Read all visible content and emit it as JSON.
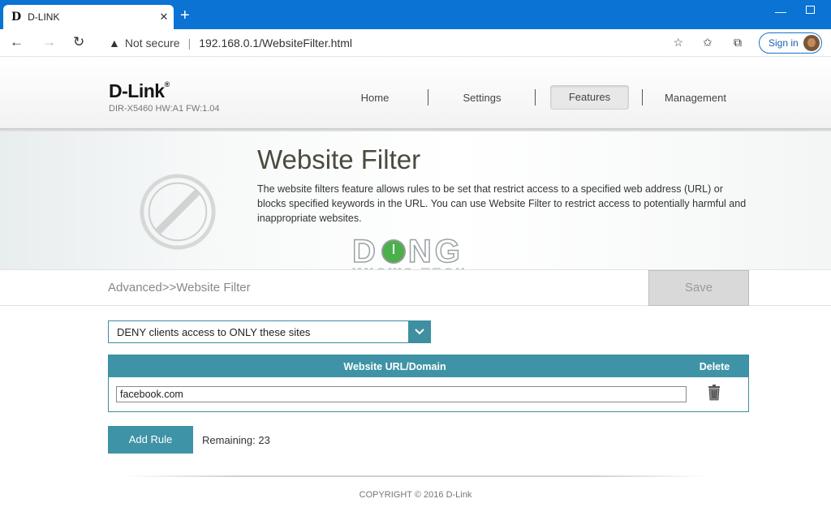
{
  "browser": {
    "tab_favicon": "D",
    "tab_title": "D-LINK",
    "tab_close": "✕",
    "new_tab": "+",
    "minimize": "—",
    "address": {
      "security_label": "Not secure",
      "separator": "|",
      "url": "192.168.0.1/WebsiteFilter.html"
    },
    "sign_in_label": "Sign in"
  },
  "header": {
    "logo": "D-Link",
    "logo_mark": "®",
    "model": "DIR-X5460 HW:A1 FW:1.04",
    "nav": {
      "home": "Home",
      "settings": "Settings",
      "features": "Features",
      "management": "Management"
    },
    "active_tab": "Features"
  },
  "banner": {
    "title": "Website Filter",
    "description": "The website filters feature allows rules to be set that restrict access to a specified web address (URL) or blocks specified keywords in the URL. You can use Website Filter to restrict access to potentially harmful and inappropriate websites.",
    "watermark_top_left": "D",
    "watermark_top_right": "NG",
    "watermark_bottom": "KNOWS TECH"
  },
  "breadcrumb": "Advanced>>Website Filter",
  "save_label": "Save",
  "filter_mode": {
    "selected": "DENY clients access to ONLY these sites"
  },
  "table": {
    "headers": {
      "url": "Website URL/Domain",
      "delete": "Delete"
    },
    "rows": [
      {
        "url": "facebook.com"
      }
    ]
  },
  "add_rule_label": "Add Rule",
  "remaining": "Remaining: 23",
  "copyright": "COPYRIGHT © 2016 D-Link",
  "colors": {
    "accent": "#3f93a6",
    "browser_bar": "#0a73d3",
    "save_disabled": "#d9d9d9"
  }
}
